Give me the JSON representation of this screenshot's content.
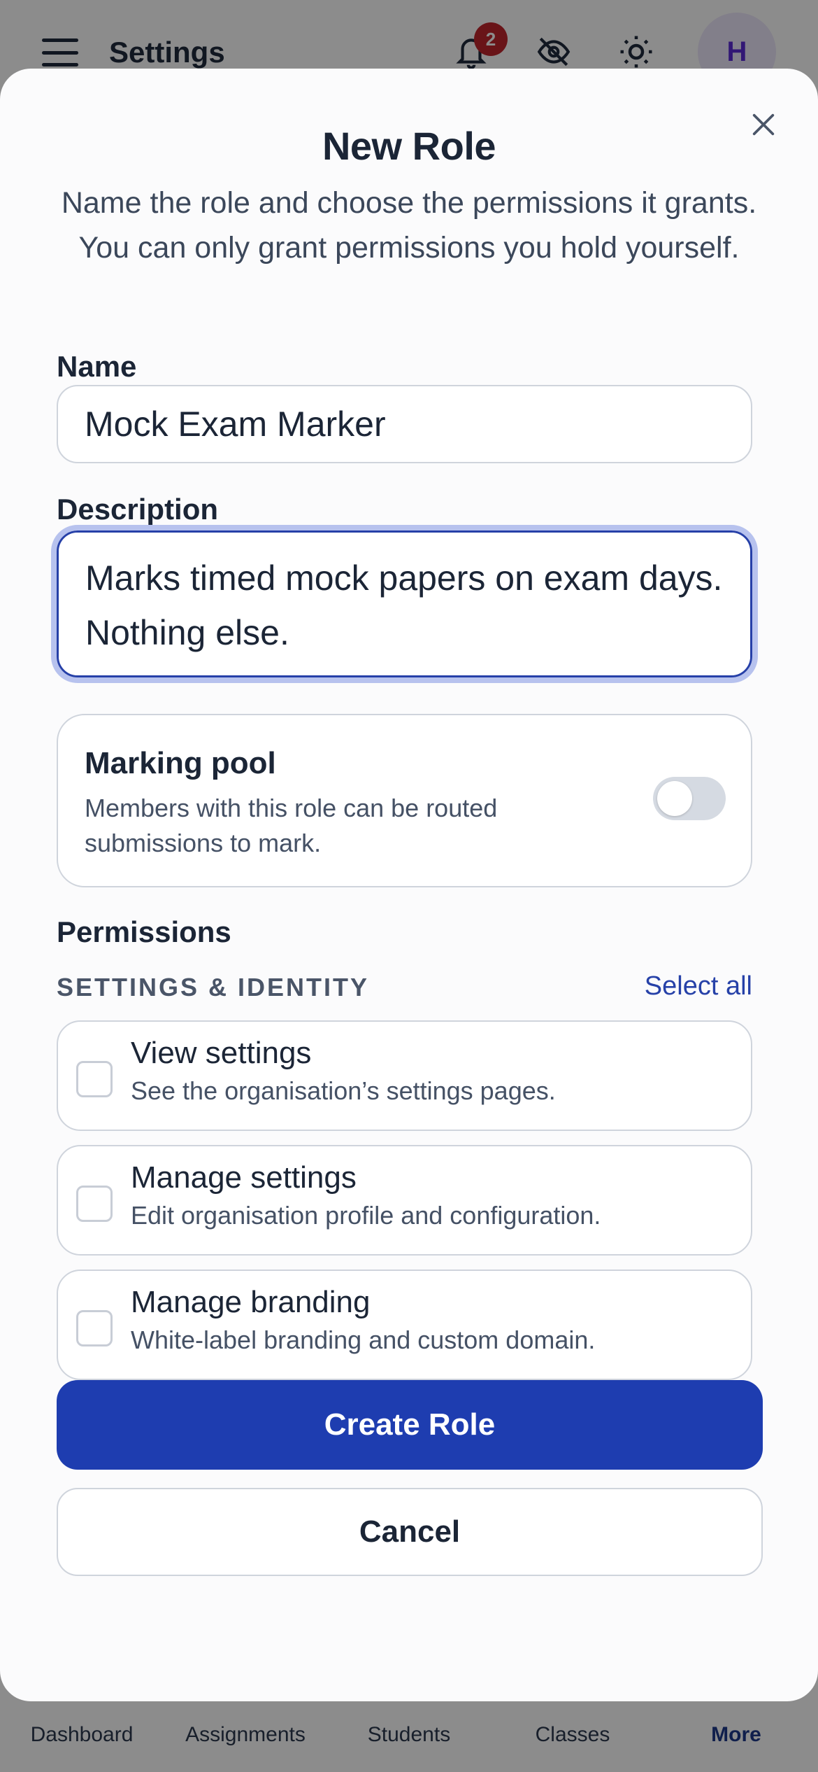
{
  "app": {
    "title": "Settings",
    "notification_count": "2",
    "avatar_initial": "H"
  },
  "bottom_nav": [
    {
      "label": "Dashboard"
    },
    {
      "label": "Assignments"
    },
    {
      "label": "Students"
    },
    {
      "label": "Classes"
    },
    {
      "label": "More",
      "active": true
    }
  ],
  "modal": {
    "title": "New Role",
    "subtitle": "Name the role and choose the permissions it grants. You can only grant permissions you hold yourself.",
    "name_label": "Name",
    "name_value": "Mock Exam Marker",
    "description_label": "Description",
    "description_value": "Marks timed mock papers on exam days. Nothing else.",
    "marking_pool": {
      "title": "Marking pool",
      "description": "Members with this role can be routed submissions to mark.",
      "enabled": false
    },
    "permissions_label": "Permissions",
    "group": {
      "title": "SETTINGS & IDENTITY",
      "select_all": "Select all",
      "items": [
        {
          "title": "View settings",
          "description": "See the organisation’s settings pages.",
          "checked": false
        },
        {
          "title": "Manage settings",
          "description": "Edit organisation profile and configuration.",
          "checked": false
        },
        {
          "title": "Manage branding",
          "description": "White-label branding and custom domain.",
          "checked": false
        }
      ]
    },
    "create_label": "Create Role",
    "cancel_label": "Cancel"
  },
  "colors": {
    "primary": "#1e3db0",
    "badge": "#c0262d",
    "focus_ring": "#b7c2ee"
  }
}
